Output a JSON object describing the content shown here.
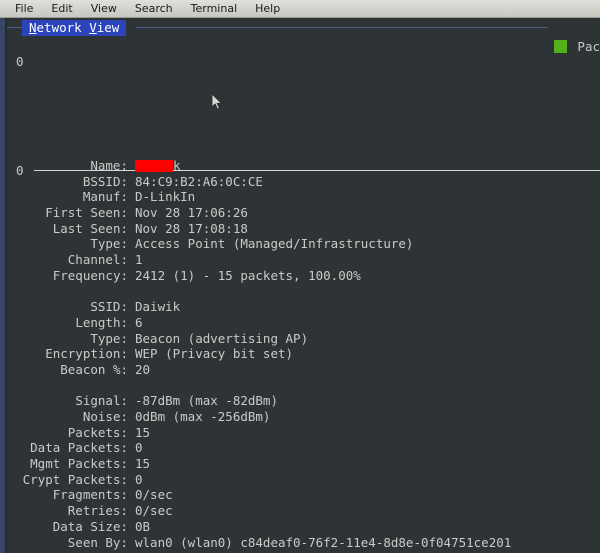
{
  "menubar": {
    "items": [
      {
        "label": "File"
      },
      {
        "label": "Edit"
      },
      {
        "label": "View"
      },
      {
        "label": "Search"
      },
      {
        "label": "Terminal"
      },
      {
        "label": "Help"
      }
    ]
  },
  "tab": {
    "accel_first": "N",
    "text_rest_first": "etwork ",
    "accel_second": "V",
    "text_rest_second": "iew",
    "full_label": "Network View"
  },
  "legend": {
    "label": "Pac",
    "swatch_color": "#54b01b"
  },
  "graph": {
    "axis_top_label": "0",
    "axis_bottom_label": "0"
  },
  "colors": {
    "background": "#2e3436",
    "text": "#c8ccc8",
    "tab_highlight": "#2b44bb",
    "redaction": "#fe0000",
    "menubar": "#d2d2cd"
  },
  "details": {
    "rows": [
      {
        "label": "Name:",
        "value": "",
        "redacted": true,
        "suffix": "k"
      },
      {
        "label": "BSSID:",
        "value": "84:C9:B2:A6:0C:CE"
      },
      {
        "label": "Manuf:",
        "value": "D-LinkIn"
      },
      {
        "label": "First Seen:",
        "value": "Nov 28 17:06:26"
      },
      {
        "label": "Last Seen:",
        "value": "Nov 28 17:08:18"
      },
      {
        "label": "Type:",
        "value": "Access Point (Managed/Infrastructure)"
      },
      {
        "label": "Channel:",
        "value": "1"
      },
      {
        "label": "Frequency:",
        "value": "2412 (1) - 15 packets, 100.00%"
      },
      {
        "label": "",
        "value": "",
        "spacer": true
      },
      {
        "label": "SSID:",
        "value": "Daiwik"
      },
      {
        "label": "Length:",
        "value": "6"
      },
      {
        "label": "Type:",
        "value": "Beacon (advertising AP)"
      },
      {
        "label": "Encryption:",
        "value": "WEP (Privacy bit set)"
      },
      {
        "label": "Beacon %:",
        "value": "20"
      },
      {
        "label": "",
        "value": "",
        "spacer": true
      },
      {
        "label": "Signal:",
        "value": "-87dBm (max -82dBm)"
      },
      {
        "label": "Noise:",
        "value": "0dBm (max -256dBm)"
      },
      {
        "label": "Packets:",
        "value": "15"
      },
      {
        "label": "Data Packets:",
        "value": "0"
      },
      {
        "label": "Mgmt Packets:",
        "value": "15"
      },
      {
        "label": "Crypt Packets:",
        "value": "0"
      },
      {
        "label": "Fragments:",
        "value": "0/sec"
      },
      {
        "label": "Retries:",
        "value": "0/sec"
      },
      {
        "label": "Data Size:",
        "value": "0B"
      },
      {
        "label": "Seen By:",
        "value": "wlan0 (wlan0) c84deaf0-76f2-11e4-8d8e-0f04751ce201"
      }
    ]
  }
}
